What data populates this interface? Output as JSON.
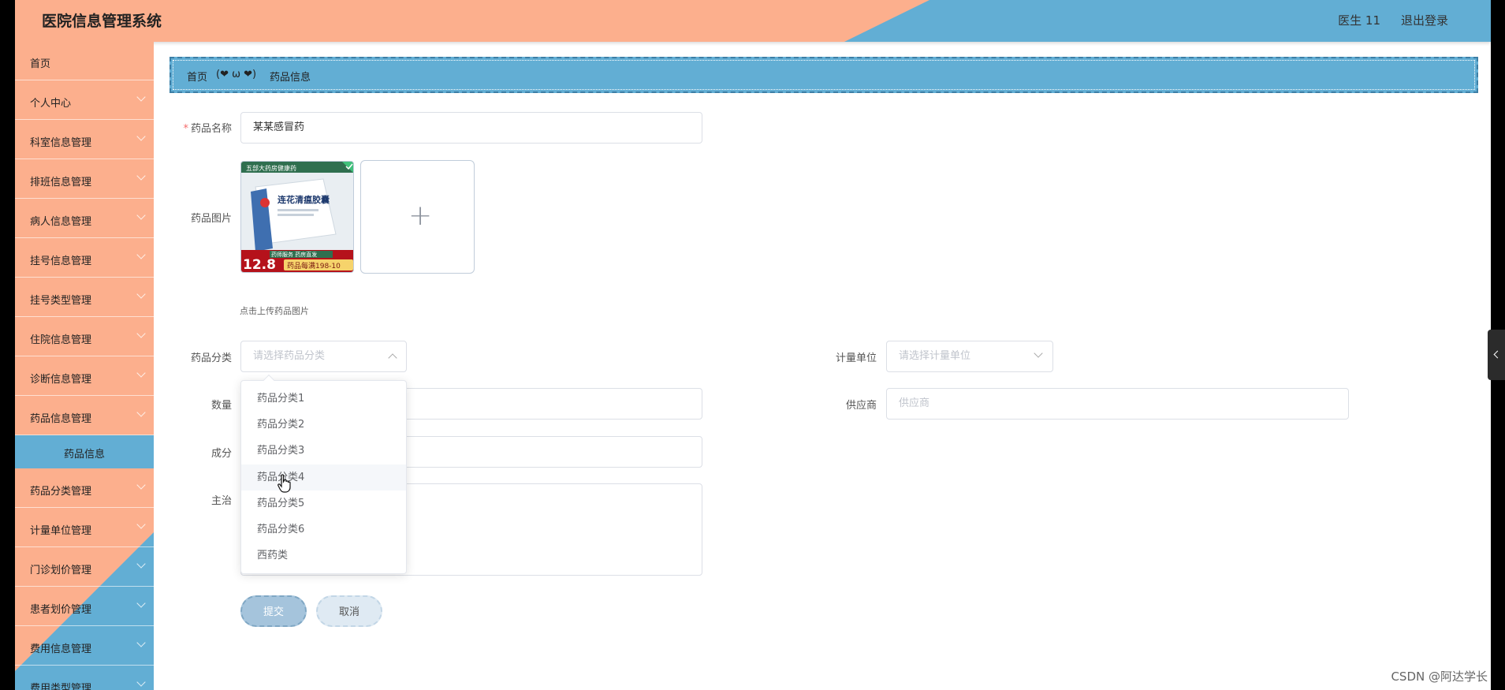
{
  "header": {
    "title": "医院信息管理系统",
    "user": "医生 11",
    "logout": "退出登录"
  },
  "sidebar": {
    "items": [
      {
        "label": "首页"
      },
      {
        "label": "个人中心"
      },
      {
        "label": "科室信息管理"
      },
      {
        "label": "排班信息管理"
      },
      {
        "label": "病人信息管理"
      },
      {
        "label": "挂号信息管理"
      },
      {
        "label": "挂号类型管理"
      },
      {
        "label": "住院信息管理"
      },
      {
        "label": "诊断信息管理"
      },
      {
        "label": "药品信息管理"
      }
    ],
    "active": "药品信息",
    "items_after": [
      {
        "label": "药品分类管理"
      },
      {
        "label": "计量单位管理"
      },
      {
        "label": "门诊划价管理"
      },
      {
        "label": "患者划价管理"
      },
      {
        "label": "费用信息管理"
      },
      {
        "label": "费用类型管理"
      }
    ]
  },
  "breadcrumb": {
    "home": "首页",
    "separator": "(❤ ω ❤)",
    "current": "药品信息"
  },
  "form": {
    "name_label": "药品名称",
    "name_value": "某某感冒药",
    "image_label": "药品图片",
    "image_hint": "点击上传药品图片",
    "image_text": {
      "top": "五部大药房健康药",
      "title": "连花清瘟胶囊",
      "price": "12.8",
      "promo": "药品每满198-10",
      "service": "药师服务 药房直发"
    },
    "category_label": "药品分类",
    "category_placeholder": "请选择药品分类",
    "unit_label": "计量单位",
    "unit_placeholder": "请选择计量单位",
    "quantity_label": "数量",
    "supplier_label": "供应商",
    "supplier_placeholder": "供应商",
    "ingredient_label": "成分",
    "treatment_label": "主治",
    "submit": "提交",
    "cancel": "取消"
  },
  "dropdown": {
    "options": [
      "药品分类1",
      "药品分类2",
      "药品分类3",
      "药品分类4",
      "药品分类5",
      "药品分类6",
      "西药类"
    ],
    "hovered_index": 3
  },
  "watermark": "CSDN @阿达学长",
  "colors": {
    "salmon": "#fcaf8d",
    "blue": "#62aed4",
    "required": "#f56c6c"
  }
}
